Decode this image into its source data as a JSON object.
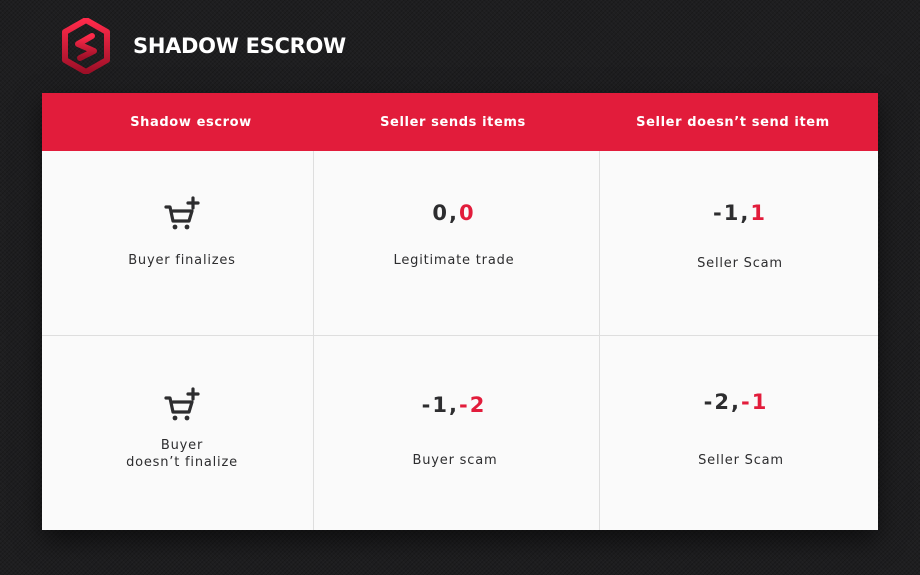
{
  "brand": {
    "title": "SHADOW ESCROW",
    "accent": "#e21c3b",
    "logo_icon": "shield-hexagon-s-icon"
  },
  "table": {
    "headers": [
      "Shadow escrow",
      "Seller sends items",
      "Seller doesn’t send item"
    ],
    "rows": [
      {
        "label": "Buyer finalizes",
        "icon": "cart-plus-icon",
        "cells": [
          {
            "payoff_a": "0,",
            "payoff_b": "0",
            "outcome": "Legitimate trade"
          },
          {
            "payoff_a": "-1,",
            "payoff_b": "1",
            "outcome": "Seller Scam"
          }
        ]
      },
      {
        "label_line1": "Buyer",
        "label_line2": "doesn’t finalize",
        "icon": "cart-plus-icon",
        "cells": [
          {
            "payoff_a": "-1,",
            "payoff_b": "-2",
            "outcome": "Buyer scam"
          },
          {
            "payoff_a": "-2,",
            "payoff_b": "-1",
            "outcome": "Seller Scam"
          }
        ]
      }
    ]
  }
}
